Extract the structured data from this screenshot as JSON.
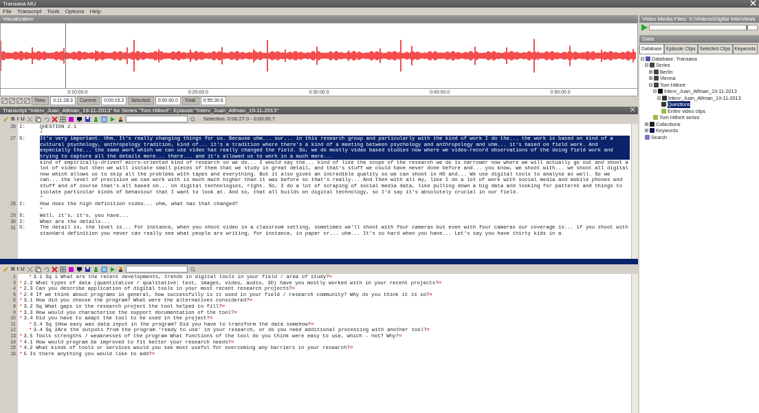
{
  "window": {
    "title": "Transana MU"
  },
  "menu": [
    "File",
    "Transcript",
    "Tools",
    "Options",
    "Help"
  ],
  "visualization": {
    "title": "Visualization",
    "time_labels": [
      "0:10:00.0",
      "0:20:00.0",
      "0:30:00.0",
      "0:40:00.0",
      "0:50:00.0"
    ],
    "status": [
      {
        "label": "Time:",
        "value": "0:11:28.3"
      },
      {
        "label": "Current:",
        "value": "0:00:15.2"
      },
      {
        "label": "Selected:",
        "value": "0:00:00.0"
      },
      {
        "label": "Total:",
        "value": "0:55:39.6"
      }
    ]
  },
  "transcript_top": {
    "title": "Transcript \"Interv_Juan_Alfman_19-11-2013\" for Series \"Tom Hilbert\", Episode \"Interv_Juan_Alfman_19-11-2013\"",
    "format_glyphs": [
      "B",
      "I",
      "U"
    ],
    "selection": "Selection: 0:00:27.0 - 0:00:00.7",
    "lines": [
      {
        "number": "26",
        "speaker": "I:",
        "segments": [
          {
            "text": "QUESTION 2.1",
            "selected": false
          }
        ],
        "mark": "*"
      },
      {
        "number": "27",
        "speaker": "S:",
        "segments": [
          {
            "text": "It's very important. Uhm. It's really changing things for us. Because uhm... our... in this research group and particularly with the kind of work I do the... the work is based on kind of a cultural psychology, anthropology tradition, kind of... it's a tradition where there's a kind of a meeting between psychology and anthropology and uhm... it's based on field work. And especially the... the same work which we can use video has really changed the field. So, we do mostly video based studies now where we video-record observations of the doing field work and trying to capture all the details more... there... and it's allowed us to work in a much more...",
            "selected": true
          },
          {
            "text": "kind of empirically-driven? micro-oriented kind of research so we do... I would say the... kind of like the scope of the research we do is narrower now where we will actually go out and shoot a lot of video but then we will isolate small pieces of them that we study in great detail, and that's stuff we could have never done before and... you know, we shoot with... we shoot all digital now which allows us to skip all the problems with tapes and everything. But it also gives an incredible quality so we can shoot in HD and... We use digital tools to analyse as well. So we can... the level of precision we can work with is much much higher than it was before so that's really... And then with all my, like I do a lot of work with social media and mobile phones and stuff and of course that's all based on... on digital technologies, right. So, I do a lot of scraping of social media data, like pulling down a big data and looking for patterns and things to isolate particular kinds of behaviour that I want to look at. And so, that all builds on digital technology, so I'd say it's absolutely crucial in our field.",
            "selected": false
          }
        ],
        "mark": "*"
      },
      {
        "number": "28",
        "speaker": "I:",
        "segments": [
          {
            "text": "How does the high definition video... uhm, what has that changed?",
            "selected": false
          }
        ],
        "mark": "*"
      },
      {
        "number": "29",
        "speaker": "S:",
        "segments": [
          {
            "text": "Well, it's, it's, you have...",
            "selected": false
          }
        ]
      },
      {
        "number": "30",
        "speaker": "I:",
        "segments": [
          {
            "text": "What are the details...",
            "selected": false
          }
        ]
      },
      {
        "number": "31",
        "speaker": "S:",
        "segments": [
          {
            "text": "The detail is, the level is... For instance, when you shoot video in a classroom setting, sometimes we'll shoot with four cameras but even with four cameras our coverage is... if you shoot with standard definition you never can really see what people are writing, for instance, in paper or... uhm... It's so hard when you have... Let's say you have thirty kids in a",
            "selected": false
          }
        ]
      }
    ]
  },
  "transcript_bottom": {
    "format_glyphs": [
      "B",
      "I",
      "U"
    ],
    "lines": [
      {
        "number": "1",
        "text": "3.1 Sq 1 What are the recent developments, trends in digital tools in your field / area of study?",
        "mark": "*",
        "end": "¤",
        "indented": true
      },
      {
        "number": "3",
        "text": "2.2 What types of data (quantitative / qualitative: text, images, video, audio, 3D) have you mostly worked with in your recent projects?",
        "mark": "*",
        "end": "¤",
        "indented": false
      },
      {
        "number": "4",
        "text": "2.3 Can you describe application of digital tools in your most recent research projects?",
        "mark": "*",
        "end": "¤",
        "indented": false
      },
      {
        "number": "5",
        "text": "2.4 If we think about programs in general, how successfully is it used in your field / research community? Why do you think it is so?",
        "mark": "*",
        "end": "¤",
        "indented": false
      },
      {
        "number": "6",
        "text": "3.1 How did you choose the program? What were the alternatives considered?",
        "mark": "*",
        "end": "¤",
        "indented": false
      },
      {
        "number": "8",
        "text": "3.2 Sq What gaps in the research project the tool helped to fill?",
        "mark": "*",
        "end": "¤",
        "indented": false
      },
      {
        "number": "9",
        "text": "3.3 How would you characterise the support documentation of the tool?",
        "mark": "*",
        "end": "¤",
        "indented": false
      },
      {
        "number": "10",
        "text": "3.4 Did you have to adapt the tool to be used in the project?",
        "mark": "*",
        "end": "¤",
        "indented": false
      },
      {
        "number": "11",
        "text": "3.4 Sq 1How easy was data input in the program? Did you have to transform the data somehow?",
        "mark": "*",
        "end": "¤",
        "indented": true
      },
      {
        "number": "12",
        "text": "3.4 Sq 2Are the outputs from the program 'ready to use' in your research, or do you need additional processing with another tool?",
        "mark": "*",
        "end": "¤",
        "indented": true
      },
      {
        "number": "13",
        "text": "3.5 Tools strengths / weaknesses of the program What functions of the tool do you think were easy to use, which - not? Why?",
        "mark": "*",
        "end": "¤",
        "indented": false
      },
      {
        "number": "14",
        "text": "4.1 How would program be improved to fit better your research needs?",
        "mark": "*",
        "end": "¤",
        "indented": false
      },
      {
        "number": "15",
        "text": "4.2 What kinds of tools or services would you see most useful for overcoming any barriers in your research?",
        "mark": "*",
        "end": "¤",
        "indented": false
      },
      {
        "number": "16",
        "text": "5 Is there anything you would like to add?",
        "mark": "*",
        "end": "¤",
        "indented": false
      }
    ]
  },
  "media": {
    "title": "Video Media Files: X:\\Videos\\Digital Interviews",
    "volume": {
      "level": 0.9
    }
  },
  "data": {
    "title": "Data",
    "tabs": [
      {
        "label": "Database",
        "selected": true
      },
      {
        "label": "Episode Clips",
        "selected": false
      },
      {
        "label": "Selected Clips",
        "selected": false
      },
      {
        "label": "Keywords",
        "selected": false
      }
    ],
    "tree": [
      {
        "label": "Database: Transana",
        "kind": "database",
        "expanded": true,
        "selected": false,
        "children": [
          {
            "label": "Series",
            "kind": "series",
            "expanded": true,
            "selected": false,
            "children": [
              {
                "label": "Berlin",
                "kind": "series",
                "expanded": false,
                "selected": false
              },
              {
                "label": "Vienna",
                "kind": "series",
                "expanded": false,
                "selected": false
              },
              {
                "label": "Tom Hilbert",
                "kind": "series",
                "expanded": true,
                "selected": false,
                "children": [
                  {
                    "label": "Interv_Juan_Alfman_19-11-2013",
                    "kind": "episode",
                    "expanded": true,
                    "selected": false,
                    "children": [
                      {
                        "label": "Interv_Juan_Alfman_19-11-2013",
                        "kind": "transcript",
                        "expanded": true,
                        "selected": false,
                        "children": [
                          {
                            "label": "Questions",
                            "kind": "transcript",
                            "selected": true
                          },
                          {
                            "label": "Entire video clips",
                            "kind": "note",
                            "selected": false
                          }
                        ]
                      }
                    ]
                  },
                  {
                    "label": "Tom Hilbert series",
                    "kind": "note",
                    "selected": false
                  }
                ]
              }
            ]
          },
          {
            "label": "Collections",
            "kind": "collection",
            "expanded": false,
            "selected": false
          },
          {
            "label": "Keywords",
            "kind": "keyword",
            "expanded": false,
            "selected": false
          },
          {
            "label": "Search",
            "kind": "search",
            "selected": false
          }
        ]
      }
    ]
  }
}
